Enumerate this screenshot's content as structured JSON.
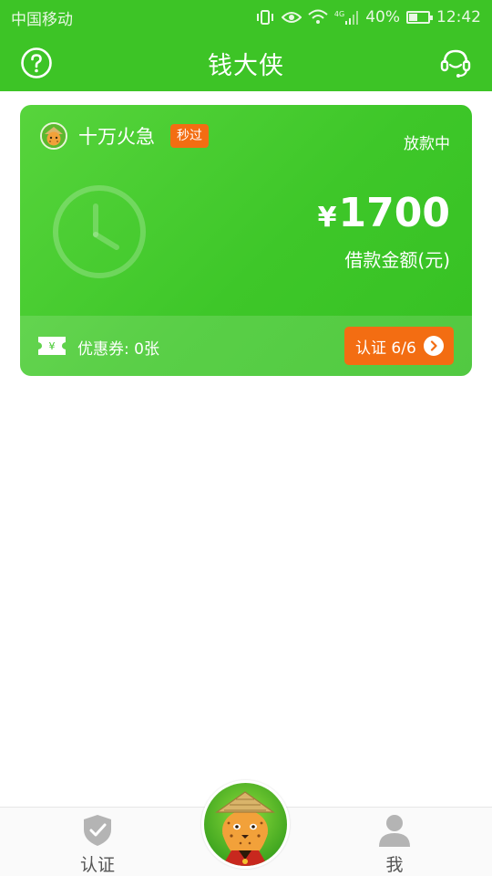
{
  "status_bar": {
    "carrier": "中国移动",
    "network": "4G",
    "battery": "40%",
    "time": "12:42"
  },
  "header": {
    "title": "钱大侠",
    "help_icon": "question-circle-icon",
    "service_icon": "headset-icon"
  },
  "loan_card": {
    "product_name": "十万火急",
    "tag": "秒过",
    "status": "放款中",
    "currency_symbol": "¥",
    "amount": "1700",
    "amount_label": "借款金额(元)",
    "coupon_text": "优惠券: 0张",
    "verify_button": "认证 6/6"
  },
  "tab_bar": {
    "left_label": "认证",
    "right_label": "我"
  },
  "colors": {
    "brand_green": "#3dc426",
    "accent_orange": "#f36d12"
  }
}
